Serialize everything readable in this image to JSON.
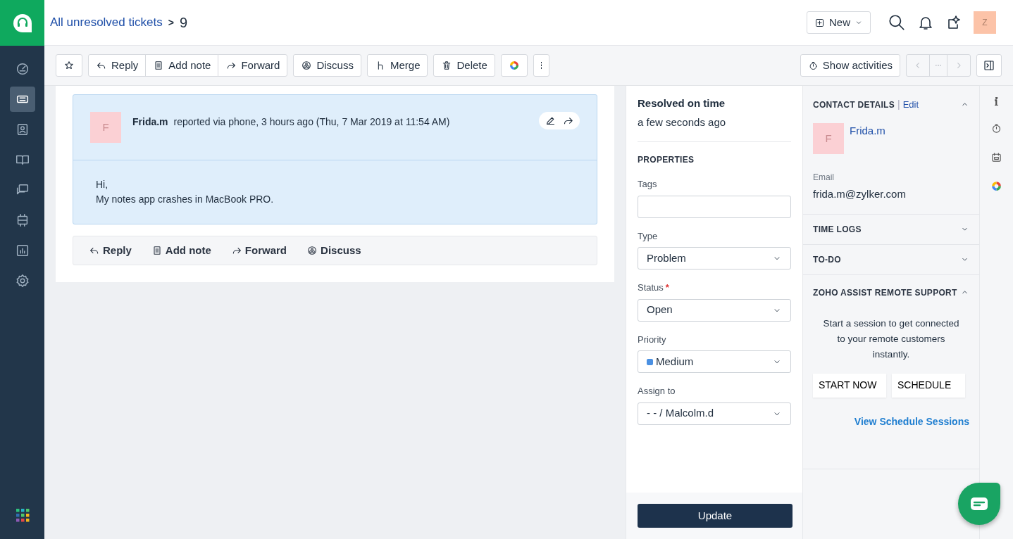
{
  "sidebar": {
    "items": [
      {
        "kind": "dashboard",
        "selected": false
      },
      {
        "kind": "tickets",
        "selected": true
      },
      {
        "kind": "contacts",
        "selected": false
      },
      {
        "kind": "book",
        "selected": false
      },
      {
        "kind": "chat",
        "selected": false
      },
      {
        "kind": "community",
        "selected": false
      },
      {
        "kind": "reports",
        "selected": false
      },
      {
        "kind": "settings",
        "selected": false
      }
    ]
  },
  "header": {
    "breadcrumb_link": "All unresolved tickets",
    "breadcrumb_separator": ">",
    "ticket_number": "9",
    "new_button": "New",
    "avatar_initial": "Z"
  },
  "toolbar": {
    "groups": [
      [
        {
          "kind": "star"
        }
      ],
      [
        {
          "kind": "reply",
          "label": "Reply"
        },
        {
          "kind": "note",
          "label": "Add note"
        },
        {
          "kind": "forward",
          "label": "Forward"
        }
      ],
      [
        {
          "kind": "discuss",
          "label": "Discuss"
        }
      ],
      [
        {
          "kind": "merge",
          "label": "Merge"
        }
      ],
      [
        {
          "kind": "trash",
          "label": "Delete"
        }
      ],
      [
        {
          "kind": "colorwheel"
        }
      ],
      [
        {
          "kind": "more"
        }
      ]
    ],
    "show_activities": "Show activities",
    "pager": [
      {
        "kind": "prev",
        "disabled": true
      },
      {
        "kind": "ellipsis",
        "disabled": true
      },
      {
        "kind": "next",
        "disabled": true
      }
    ]
  },
  "thread": {
    "initial": "F",
    "author": "Frida.m",
    "meta": "reported via phone, 3 hours ago (Thu, 7 Mar 2019 at 11:54 AM)",
    "body": [
      "Hi,",
      "My notes app crashes in MacBook PRO."
    ],
    "actions": [
      {
        "kind": "reply",
        "label": "Reply"
      },
      {
        "kind": "note",
        "label": "Add note"
      },
      {
        "kind": "forward",
        "label": "Forward"
      },
      {
        "kind": "discuss",
        "label": "Discuss"
      }
    ]
  },
  "properties": {
    "sla_status": "Resolved on time",
    "sla_time": "a few seconds ago",
    "heading": "PROPERTIES",
    "required_mark": "*",
    "fields": [
      {
        "label": "Tags",
        "kind": "input",
        "required": false
      },
      {
        "label": "Type",
        "kind": "select",
        "value": "Problem",
        "required": false
      },
      {
        "label": "Status",
        "kind": "select",
        "value": "Open",
        "required": true
      },
      {
        "label": "Priority",
        "kind": "select",
        "value": "Medium",
        "required": false,
        "color": "#4a90e2"
      },
      {
        "label": "Assign to",
        "kind": "select",
        "value": "- - / Malcolm.d",
        "required": false
      }
    ],
    "update_button": "Update"
  },
  "contact": {
    "title": "CONTACT DETAILS",
    "separator": "|",
    "edit": "Edit",
    "expanded": true,
    "initial": "F",
    "name": "Frida.m",
    "email_label": "Email",
    "email": "frida.m@zylker.com",
    "sections": [
      {
        "title": "TIME LOGS",
        "expanded": false
      },
      {
        "title": "TO-DO",
        "expanded": false
      }
    ],
    "assist": {
      "title": "ZOHO ASSIST REMOTE SUPPORT",
      "expanded": true,
      "text": "Start a session to get connected to your remote customers instantly.",
      "buttons": [
        "START NOW",
        "SCHEDULE"
      ],
      "link": "View Schedule Sessions"
    }
  },
  "rail": [
    {
      "kind": "info"
    },
    {
      "kind": "timer"
    },
    {
      "kind": "calendar"
    },
    {
      "kind": "colorwheel"
    }
  ]
}
